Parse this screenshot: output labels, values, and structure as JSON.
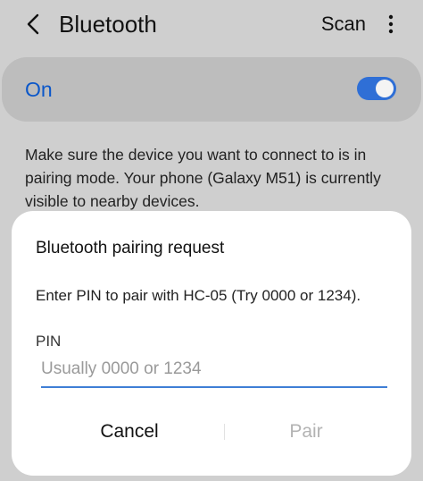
{
  "header": {
    "title": "Bluetooth",
    "scan_label": "Scan",
    "back_icon": "chevron-left-icon",
    "more_icon": "more-vertical-icon"
  },
  "toggle": {
    "label": "On",
    "state": "on",
    "accent_color": "#2f6fd6"
  },
  "description": "Make sure the device you want to connect to is in pairing mode. Your phone (Galaxy M51) is currently visible to nearby devices.",
  "dialog": {
    "title": "Bluetooth pairing request",
    "message": "Enter PIN to pair with HC-05 (Try 0000 or 1234).",
    "pin_label": "PIN",
    "pin_value": "",
    "pin_placeholder": "Usually 0000 or 1234",
    "cancel_label": "Cancel",
    "pair_label": "Pair"
  }
}
